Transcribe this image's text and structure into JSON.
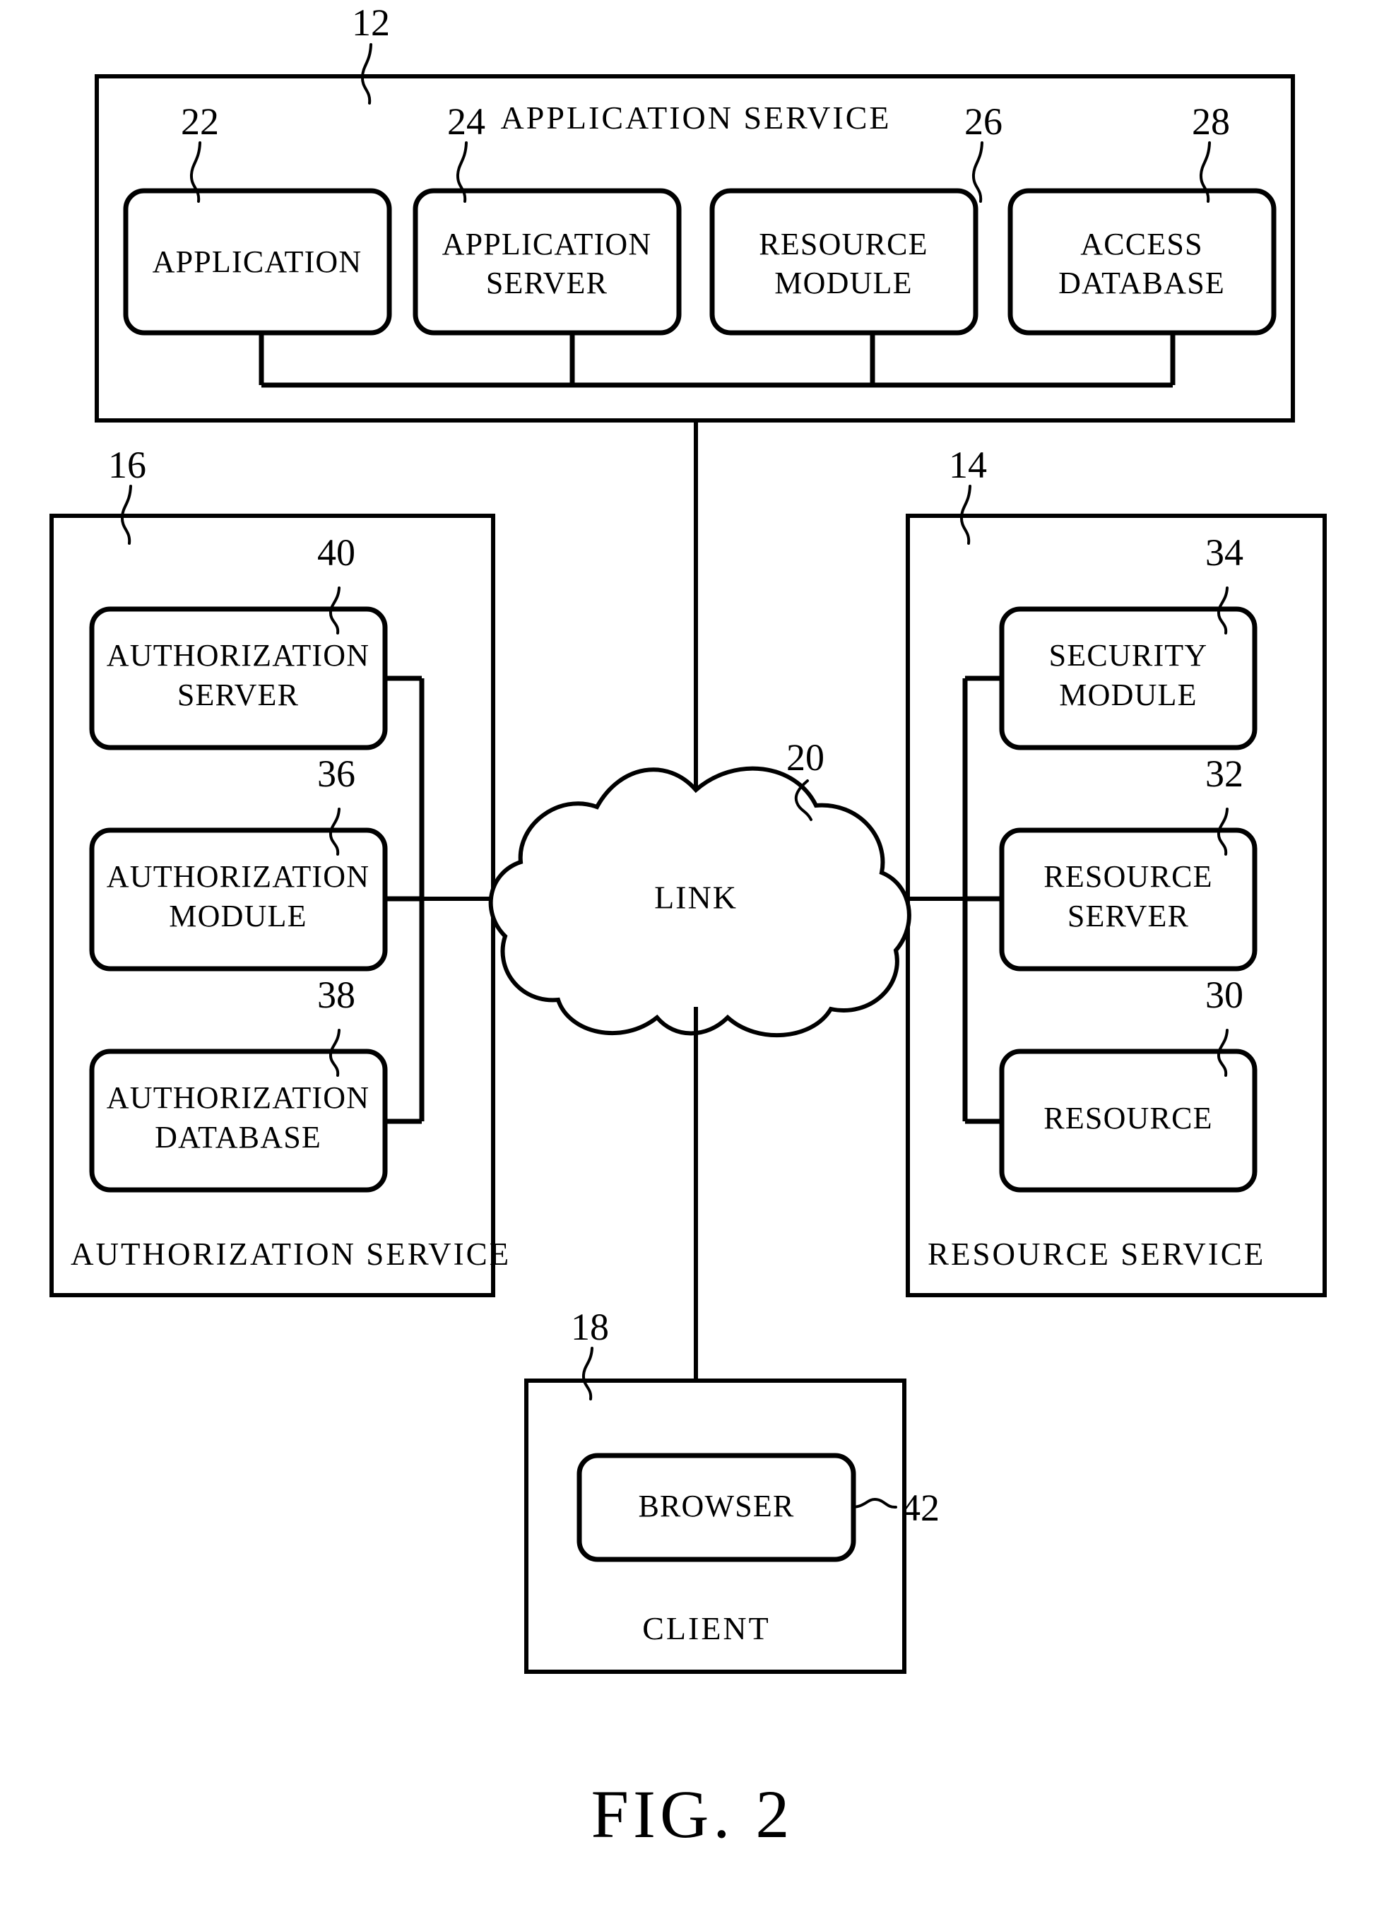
{
  "figure": {
    "caption": "FIG. 2",
    "title": "Application service authorization architecture block diagram"
  },
  "application_service": {
    "ref": "12",
    "label": "APPLICATION  SERVICE",
    "nodes": [
      {
        "ref": "22",
        "label_line1": "APPLICATION",
        "label_line2": ""
      },
      {
        "ref": "24",
        "label_line1": "APPLICATION",
        "label_line2": "SERVER"
      },
      {
        "ref": "26",
        "label_line1": "RESOURCE",
        "label_line2": "MODULE"
      },
      {
        "ref": "28",
        "label_line1": "ACCESS",
        "label_line2": "DATABASE"
      }
    ]
  },
  "authorization_service": {
    "ref": "16",
    "label": "AUTHORIZATION  SERVICE",
    "nodes": [
      {
        "ref": "40",
        "label_line1": "AUTHORIZATION",
        "label_line2": "SERVER"
      },
      {
        "ref": "36",
        "label_line1": "AUTHORIZATION",
        "label_line2": "MODULE"
      },
      {
        "ref": "38",
        "label_line1": "AUTHORIZATION",
        "label_line2": "DATABASE"
      }
    ]
  },
  "resource_service": {
    "ref": "14",
    "label": "RESOURCE  SERVICE",
    "nodes": [
      {
        "ref": "34",
        "label_line1": "SECURITY",
        "label_line2": "MODULE"
      },
      {
        "ref": "32",
        "label_line1": "RESOURCE",
        "label_line2": "SERVER"
      },
      {
        "ref": "30",
        "label_line1": "RESOURCE",
        "label_line2": ""
      }
    ]
  },
  "link": {
    "ref": "20",
    "label": "LINK"
  },
  "client": {
    "ref": "18",
    "label": "CLIENT",
    "nodes": [
      {
        "ref": "42",
        "label_line1": "BROWSER",
        "label_line2": ""
      }
    ]
  }
}
